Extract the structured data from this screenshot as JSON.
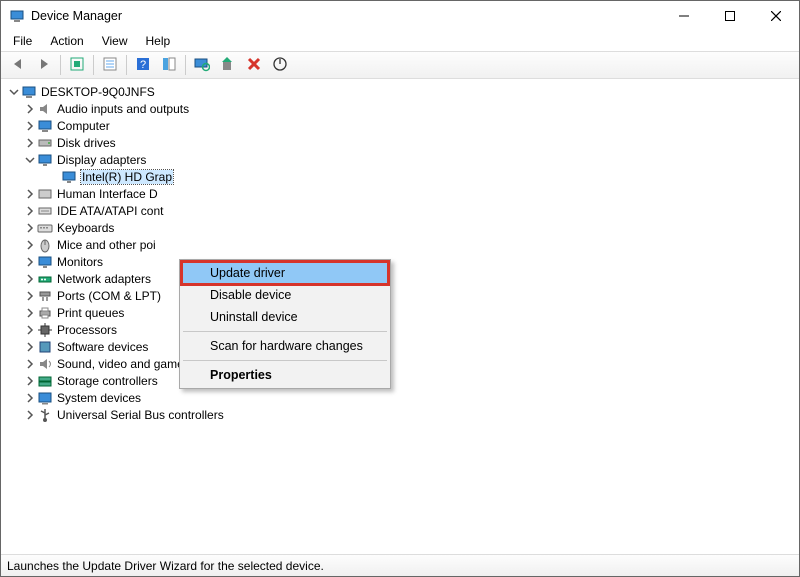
{
  "window": {
    "title": "Device Manager"
  },
  "menubar": {
    "items": [
      "File",
      "Action",
      "View",
      "Help"
    ]
  },
  "tree": {
    "root": {
      "label": "DESKTOP-9Q0JNFS",
      "icon": "computer-icon"
    },
    "categories": [
      {
        "label": "Audio inputs and outputs",
        "icon": "speaker-icon",
        "expanded": false
      },
      {
        "label": "Computer",
        "icon": "computer-icon",
        "expanded": false
      },
      {
        "label": "Disk drives",
        "icon": "drive-icon",
        "expanded": false
      },
      {
        "label": "Display adapters",
        "icon": "monitor-icon",
        "expanded": true,
        "children": [
          {
            "label": "Intel(R) HD Grap",
            "icon": "monitor-icon",
            "selected": true
          }
        ]
      },
      {
        "label": "Human Interface D",
        "icon": "hid-icon",
        "expanded": false
      },
      {
        "label": "IDE ATA/ATAPI cont",
        "icon": "ide-icon",
        "expanded": false
      },
      {
        "label": "Keyboards",
        "icon": "keyboard-icon",
        "expanded": false
      },
      {
        "label": "Mice and other poi",
        "icon": "mouse-icon",
        "expanded": false
      },
      {
        "label": "Monitors",
        "icon": "monitor-icon",
        "expanded": false
      },
      {
        "label": "Network adapters",
        "icon": "network-icon",
        "expanded": false
      },
      {
        "label": "Ports (COM & LPT)",
        "icon": "port-icon",
        "expanded": false
      },
      {
        "label": "Print queues",
        "icon": "printer-icon",
        "expanded": false
      },
      {
        "label": "Processors",
        "icon": "cpu-icon",
        "expanded": false
      },
      {
        "label": "Software devices",
        "icon": "software-icon",
        "expanded": false
      },
      {
        "label": "Sound, video and game controllers",
        "icon": "audio-icon",
        "expanded": false
      },
      {
        "label": "Storage controllers",
        "icon": "storage-icon",
        "expanded": false
      },
      {
        "label": "System devices",
        "icon": "system-icon",
        "expanded": false
      },
      {
        "label": "Universal Serial Bus controllers",
        "icon": "usb-icon",
        "expanded": false
      }
    ]
  },
  "context_menu": {
    "items": [
      {
        "label": "Update driver",
        "highlighted": true
      },
      {
        "label": "Disable device"
      },
      {
        "label": "Uninstall device"
      },
      {
        "sep": true
      },
      {
        "label": "Scan for hardware changes"
      },
      {
        "sep": true
      },
      {
        "label": "Properties",
        "bold": true
      }
    ]
  },
  "statusbar": {
    "text": "Launches the Update Driver Wizard for the selected device."
  },
  "icons": {
    "back": "back-icon",
    "forward": "forward-icon",
    "show_hidden": "show-hidden-icon",
    "properties": "properties-icon",
    "help": "help-icon",
    "list": "list-icon",
    "update": "update-icon",
    "scan": "scan-monitor-icon",
    "enable": "enable-icon",
    "delete": "delete-icon"
  }
}
